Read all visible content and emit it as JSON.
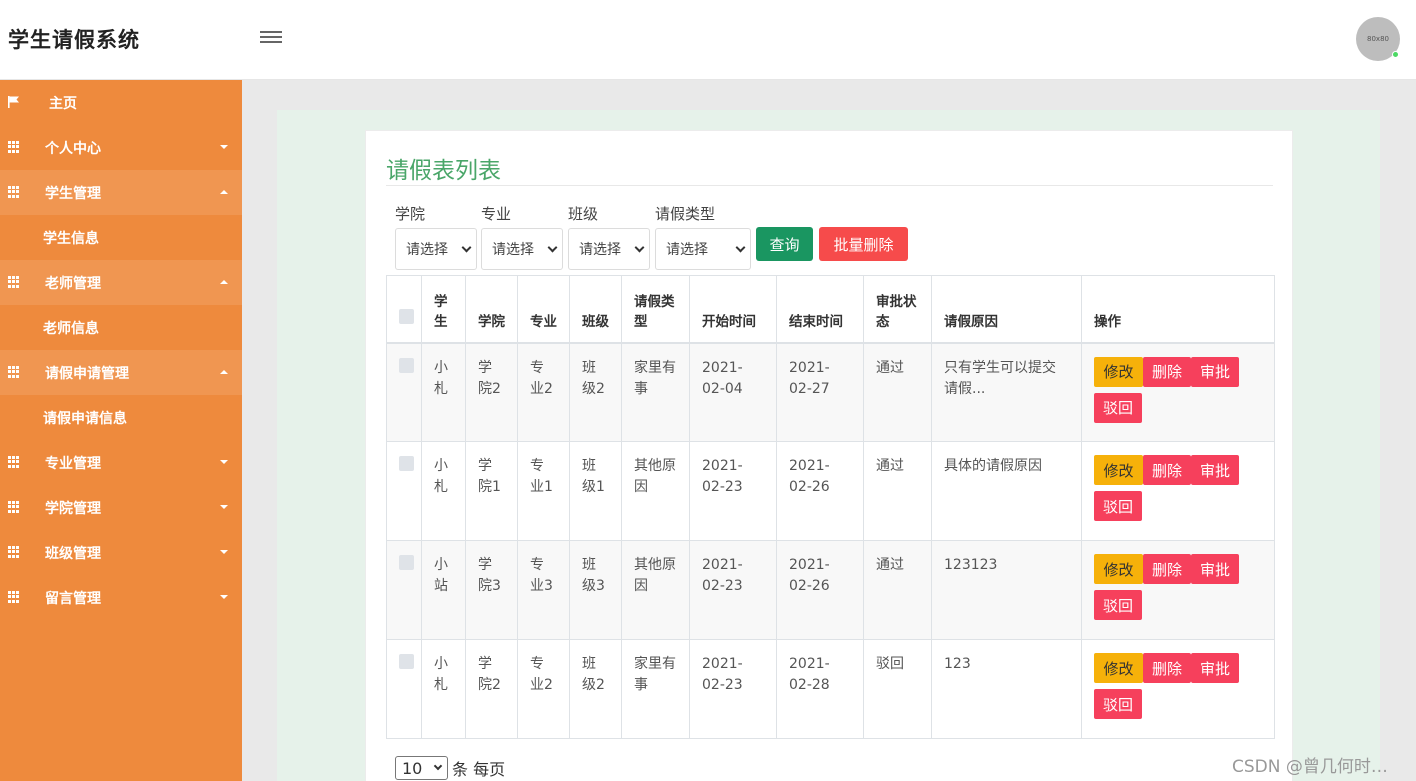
{
  "app": {
    "title": "学生请假系统",
    "avatar_text": "80x80"
  },
  "sidebar": {
    "items": [
      {
        "label": "主页",
        "icon": "flag-icon"
      },
      {
        "label": "个人中心",
        "icon": "grid-icon"
      },
      {
        "label": "学生管理",
        "icon": "grid-icon",
        "sub": "学生信息"
      },
      {
        "label": "老师管理",
        "icon": "grid-icon",
        "sub": "老师信息"
      },
      {
        "label": "请假申请管理",
        "icon": "grid-icon",
        "sub": "请假申请信息"
      },
      {
        "label": "专业管理",
        "icon": "grid-icon"
      },
      {
        "label": "学院管理",
        "icon": "grid-icon"
      },
      {
        "label": "班级管理",
        "icon": "grid-icon"
      },
      {
        "label": "留言管理",
        "icon": "grid-icon"
      }
    ]
  },
  "main": {
    "title": "请假表列表",
    "filters": [
      {
        "label": "学院",
        "value": "请选择"
      },
      {
        "label": "专业",
        "value": "请选择"
      },
      {
        "label": "班级",
        "value": "请选择"
      },
      {
        "label": "请假类型",
        "value": "请选择"
      }
    ],
    "search_label": "查询",
    "batch_delete_label": "批量删除",
    "columns": [
      "学生",
      "学院",
      "专业",
      "班级",
      "请假类型",
      "开始时间",
      "结束时间",
      "审批状态",
      "请假原因",
      "操作"
    ],
    "rows": [
      {
        "student": "小札",
        "college": "学院2",
        "major": "专业2",
        "class": "班级2",
        "type": "家里有事",
        "start": "2021-02-04",
        "end": "2021-02-27",
        "status": "通过",
        "reason": "只有学生可以提交请假..."
      },
      {
        "student": "小札",
        "college": "学院1",
        "major": "专业1",
        "class": "班级1",
        "type": "其他原因",
        "start": "2021-02-23",
        "end": "2021-02-26",
        "status": "通过",
        "reason": "具体的请假原因"
      },
      {
        "student": "小站",
        "college": "学院3",
        "major": "专业3",
        "class": "班级3",
        "type": "其他原因",
        "start": "2021-02-23",
        "end": "2021-02-26",
        "status": "通过",
        "reason": "123123"
      },
      {
        "student": "小札",
        "college": "学院2",
        "major": "专业2",
        "class": "班级2",
        "type": "家里有事",
        "start": "2021-02-23",
        "end": "2021-02-28",
        "status": "驳回",
        "reason": "123"
      }
    ],
    "actions": {
      "edit": "修改",
      "delete": "删除",
      "approve": "审批",
      "reject": "驳回"
    },
    "pager": {
      "page_size": "10",
      "suffix": "条 每页"
    }
  },
  "watermark": "CSDN @曾几何时…",
  "colors": {
    "sidebar": "#ee8a3d",
    "title": "#4aa669",
    "search": "#1a9661",
    "danger": "#f64b4b",
    "warning": "#f6b10a"
  }
}
